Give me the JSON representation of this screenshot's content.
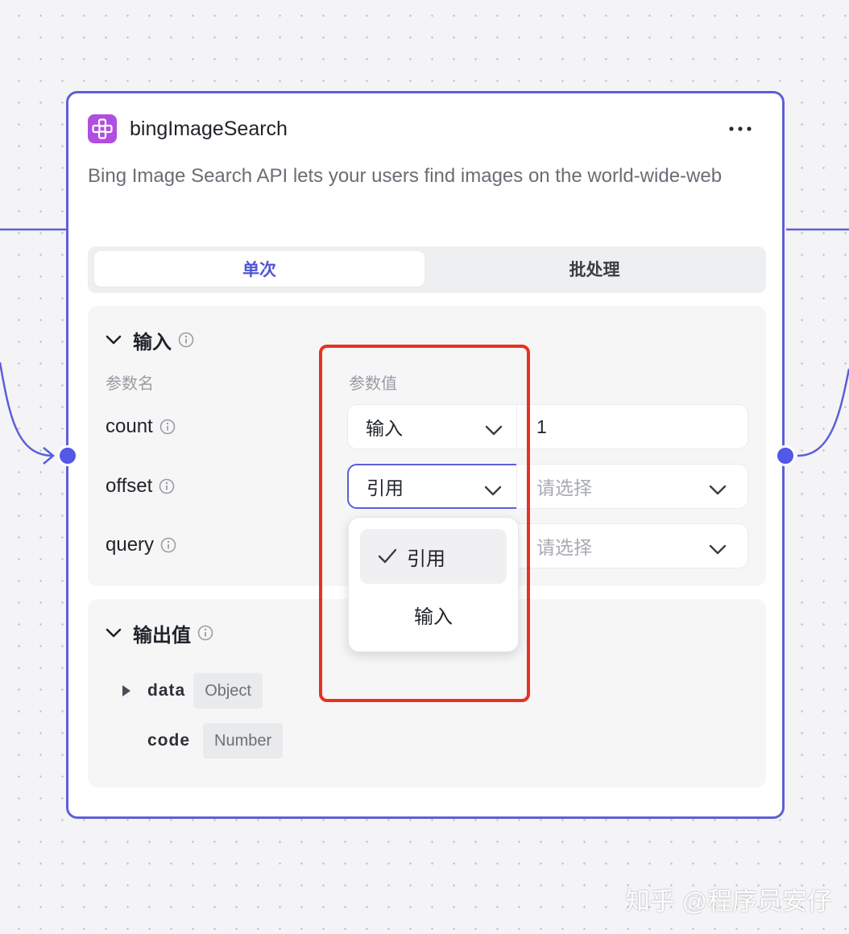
{
  "node": {
    "icon": "plugin-icon",
    "title": "bingImageSearch",
    "description": "Bing Image Search API lets your users find images on the world-wide-web",
    "more_icon": "more-horizontal-icon"
  },
  "tabs": [
    {
      "label": "单次",
      "active": true
    },
    {
      "label": "批处理",
      "active": false
    }
  ],
  "input_section": {
    "title": "输入",
    "expanded": true,
    "col_name_header": "参数名",
    "col_value_header": "参数值",
    "params": [
      {
        "name": "count",
        "type": "输入",
        "value": "1"
      },
      {
        "name": "offset",
        "type": "引用",
        "value_placeholder": "请选择"
      },
      {
        "name": "query",
        "value_placeholder": "请选择"
      }
    ]
  },
  "dropdown": {
    "options": [
      "引用",
      "输入"
    ],
    "selected": "引用"
  },
  "output_section": {
    "title": "输出值",
    "expanded": true,
    "fields": [
      {
        "name": "data",
        "type": "Object",
        "expandable": true
      },
      {
        "name": "code",
        "type": "Number",
        "expandable": false
      }
    ]
  },
  "watermark": "知乎 @程序员安仔",
  "colors": {
    "accent": "#5458e6",
    "node_border": "#5f5fd6",
    "icon_bg": "#b04ee0",
    "highlight_box": "#e8321f"
  }
}
